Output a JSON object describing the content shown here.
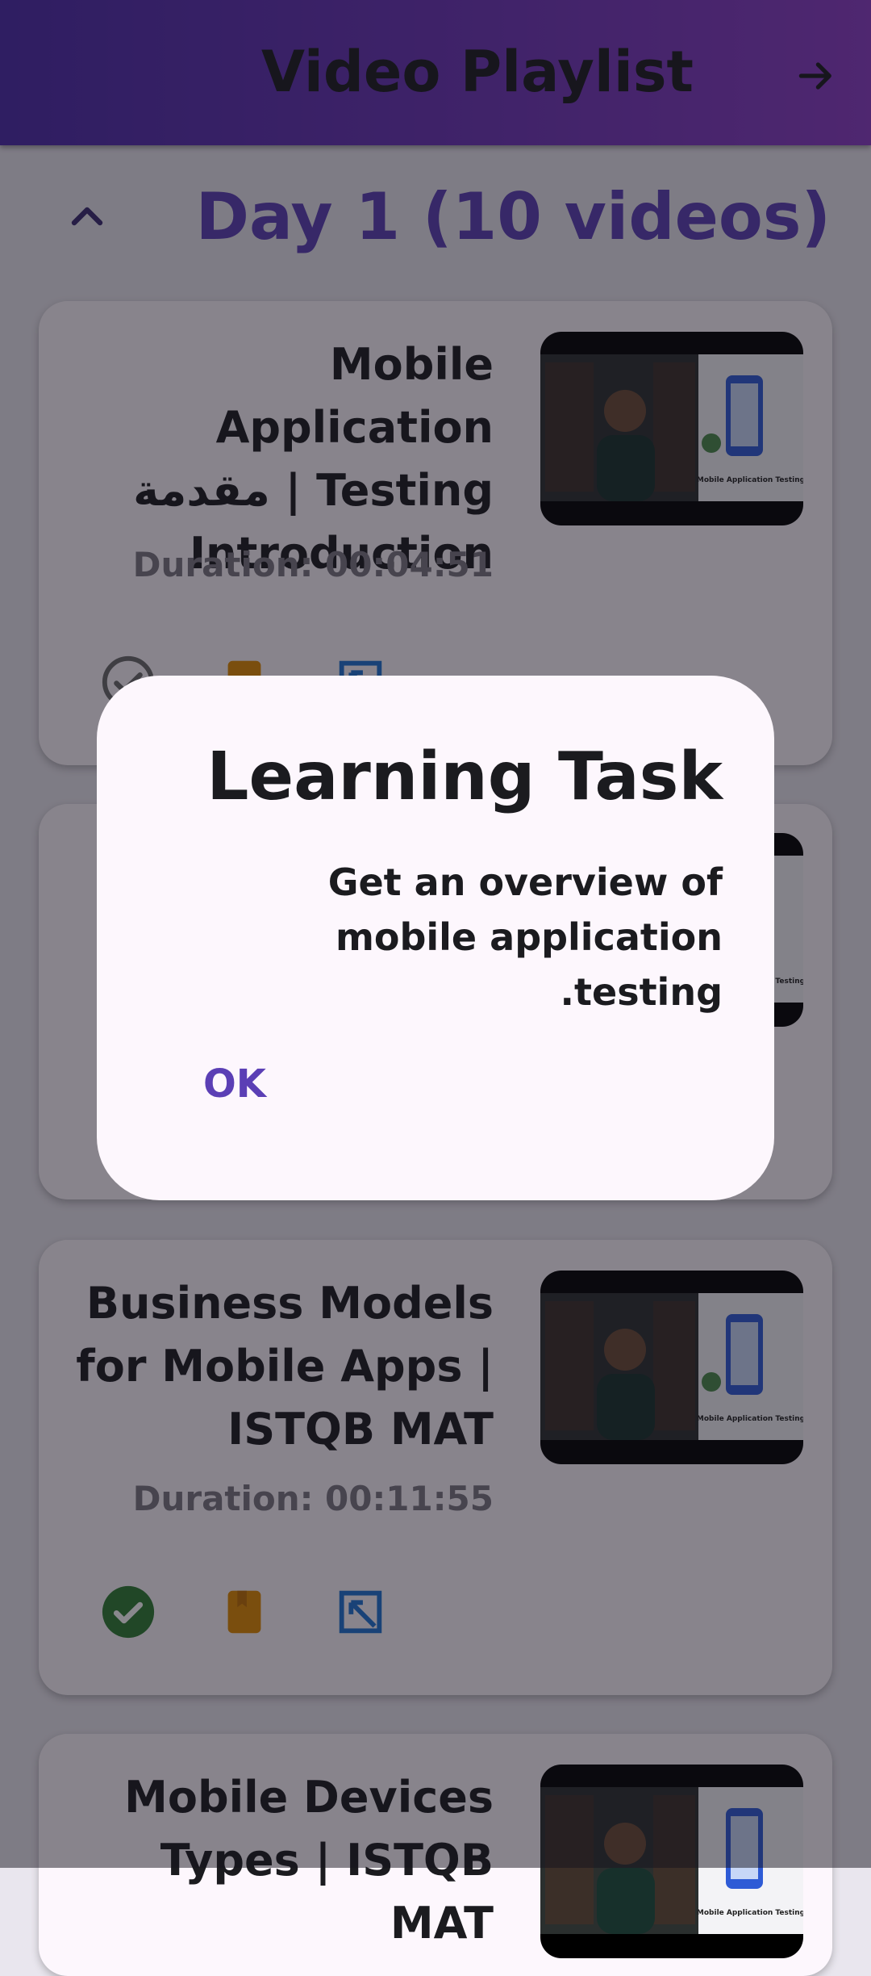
{
  "appbar": {
    "title": "Video Playlist",
    "action_icon": "arrow-forward-icon"
  },
  "section": {
    "title": "Day 1 (10 videos)",
    "toggle_icon": "chevron-up-icon"
  },
  "cards": [
    {
      "title": "Mobile Application Testing | مقدمة Introduction",
      "duration": "Duration: 00:04:51",
      "thumb_caption": "Mobile Application Testing",
      "watched": false
    },
    {
      "title": "",
      "duration": "",
      "thumb_caption": "Mobile Application Testing",
      "watched": false
    },
    {
      "title": "Business Models for Mobile Apps | ISTQB MAT",
      "duration": "Duration: 00:11:55",
      "thumb_caption": "Mobile Application Testing",
      "watched": true
    },
    {
      "title": "Mobile Devices Types | ISTQB MAT",
      "duration": "",
      "thumb_caption": "Mobile Application Testing",
      "watched": false
    }
  ],
  "dialog": {
    "title": "Learning Task",
    "body": "Get an overview of mobile application testing.",
    "ok_label": "OK"
  },
  "colors": {
    "accent": "#5b3fb5",
    "watched": "#2e7d32",
    "bookmark": "#e08a00",
    "open": "#1e73d2"
  }
}
